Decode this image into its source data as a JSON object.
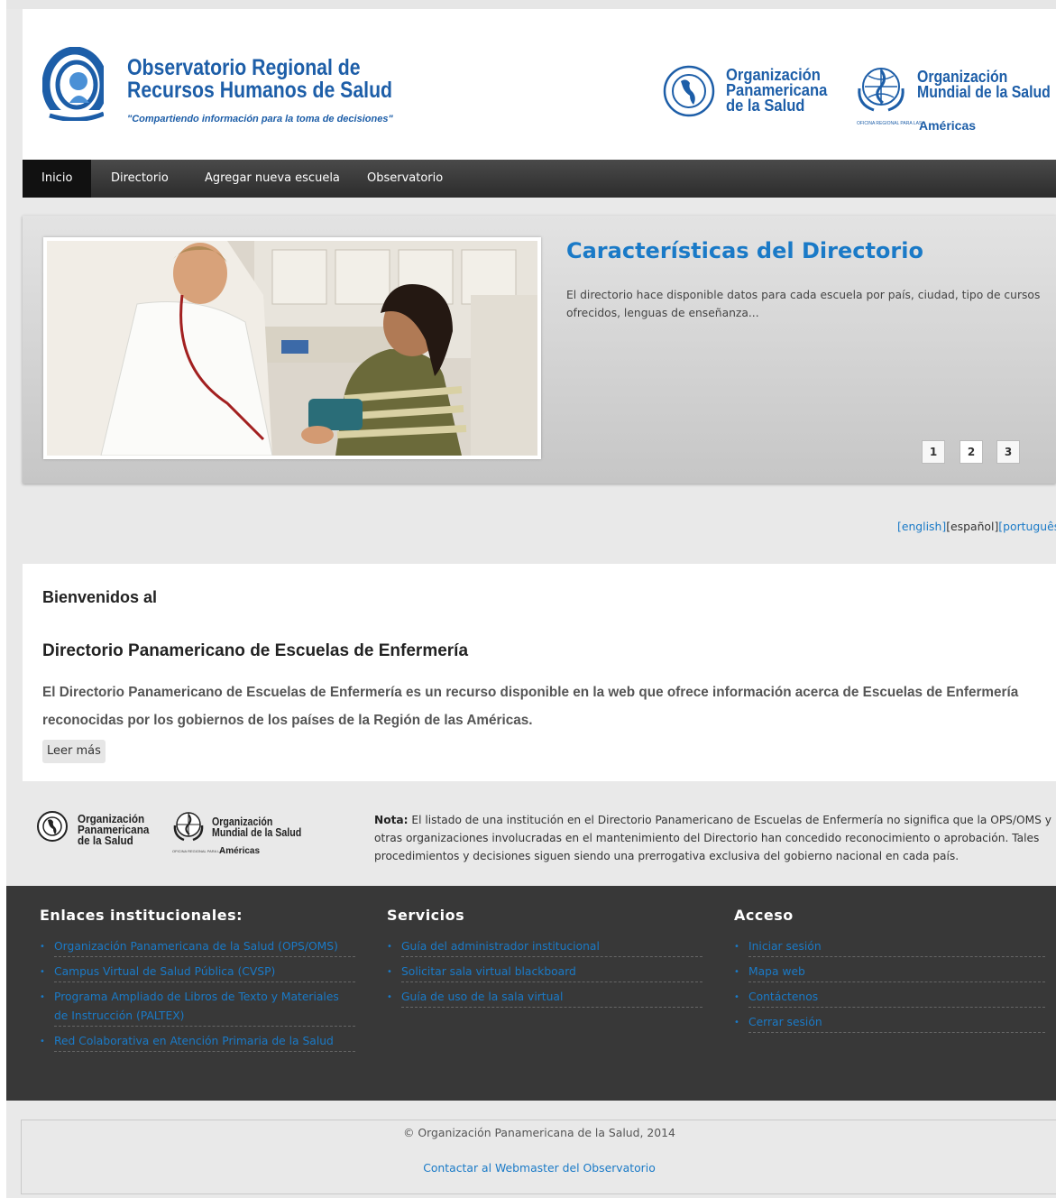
{
  "header": {
    "title_line1": "Observatorio Regional de",
    "title_line2": "Recursos Humanos de Salud",
    "tagline": "\"Compartiendo información para la toma de decisiones\"",
    "ops_line1": "Organización",
    "ops_line2": "Panamericana",
    "ops_line3": "de la Salud",
    "oms_line1": "Organización",
    "oms_line2": "Mundial de la Salud",
    "oms_sub": "OFICINA REGIONAL PARA LAS",
    "oms_region": "Américas"
  },
  "nav": {
    "items": [
      {
        "label": "Inicio"
      },
      {
        "label": "Directorio"
      },
      {
        "label": "Agregar nueva escuela"
      },
      {
        "label": "Observatorio"
      }
    ]
  },
  "slider": {
    "title": "Características del Directorio",
    "text": "El directorio hace disponible datos para cada escuela por país, ciudad, tipo de cursos ofrecidos, lenguas de enseñanza...",
    "pages": [
      "1",
      "2",
      "3"
    ],
    "current_page": "2"
  },
  "languages": {
    "english": "[english]",
    "espanol": "[español]",
    "portugues": "[português]"
  },
  "welcome": {
    "heading": "Bienvenidos al",
    "subheading": "Directorio Panamericano de Escuelas de Enfermería",
    "body": "El Directorio Panamericano de Escuelas de Enfermería es un recurso disponible en la web que ofrece información acerca de Escuelas de Enfermería reconocidas por los gobiernos de los países de la Región de las Américas.",
    "read_more": "Leer más"
  },
  "note": {
    "label": "Nota:",
    "text": " El listado de una institución en el Directorio Panamericano de Escuelas de Enfermería no significa que la OPS/OMS y otras organizaciones involucradas en el mantenimiento del Directorio han concedido reconocimiento o aprobación. Tales procedimientos y decisiones siguen siendo una prerrogativa exclusiva del gobierno nacional en cada país."
  },
  "footer": {
    "col1": {
      "title": "Enlaces institucionales:",
      "links": [
        "Organización Panamericana de la Salud (OPS/OMS)",
        "Campus Virtual de Salud Pública (CVSP)",
        "Programa Ampliado de Libros de Texto y Materiales de Instrucción (PALTEX)",
        "Red Colaborativa en Atención Primaria de la Salud"
      ]
    },
    "col2": {
      "title": "Servicios",
      "links": [
        "Guía del administrador institucional",
        "Solicitar sala virtual blackboard",
        "Guía de uso de la sala virtual"
      ]
    },
    "col3": {
      "title": "Acceso",
      "links": [
        "Iniciar sesión",
        "Mapa web",
        "Contáctenos",
        "Cerrar sesión"
      ]
    }
  },
  "copyright": {
    "text": "© Organización Panamericana de la Salud, 2014",
    "webmaster_link": "Contactar al Webmaster del Observatorio"
  },
  "colors": {
    "brand_blue": "#1d5ea8",
    "link_blue": "#1a7ac7",
    "nav_bg": "#2c2c2c",
    "footer_bg": "#383838"
  },
  "icons": [
    "observatorio-logo-icon",
    "ops-emblem-icon",
    "oms-emblem-icon"
  ]
}
